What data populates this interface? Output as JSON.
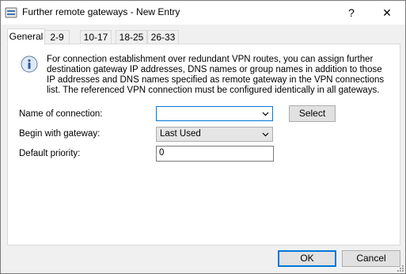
{
  "window": {
    "title": "Further remote gateways - New Entry",
    "help_label": "?",
    "close_label": "✕"
  },
  "tabs": [
    {
      "label": "General"
    },
    {
      "label": "2-9"
    },
    {
      "label": "10-17"
    },
    {
      "label": "18-25"
    },
    {
      "label": "26-33"
    }
  ],
  "info": {
    "text": "For connection establishment over redundant VPN routes, you can assign further destination gateway IP addresses, DNS names or group names in addition to those IP addresses and DNS names specified as remote gateway in the VPN connections list. The referenced VPN connection must be configured identically in all gateways."
  },
  "form": {
    "connection_label": "Name of connection:",
    "connection_value": "",
    "select_button": "Select",
    "begin_label": "Begin with gateway:",
    "begin_value": "Last Used",
    "priority_label": "Default priority:",
    "priority_value": "0"
  },
  "footer": {
    "ok_label": "OK",
    "cancel_label": "Cancel"
  }
}
